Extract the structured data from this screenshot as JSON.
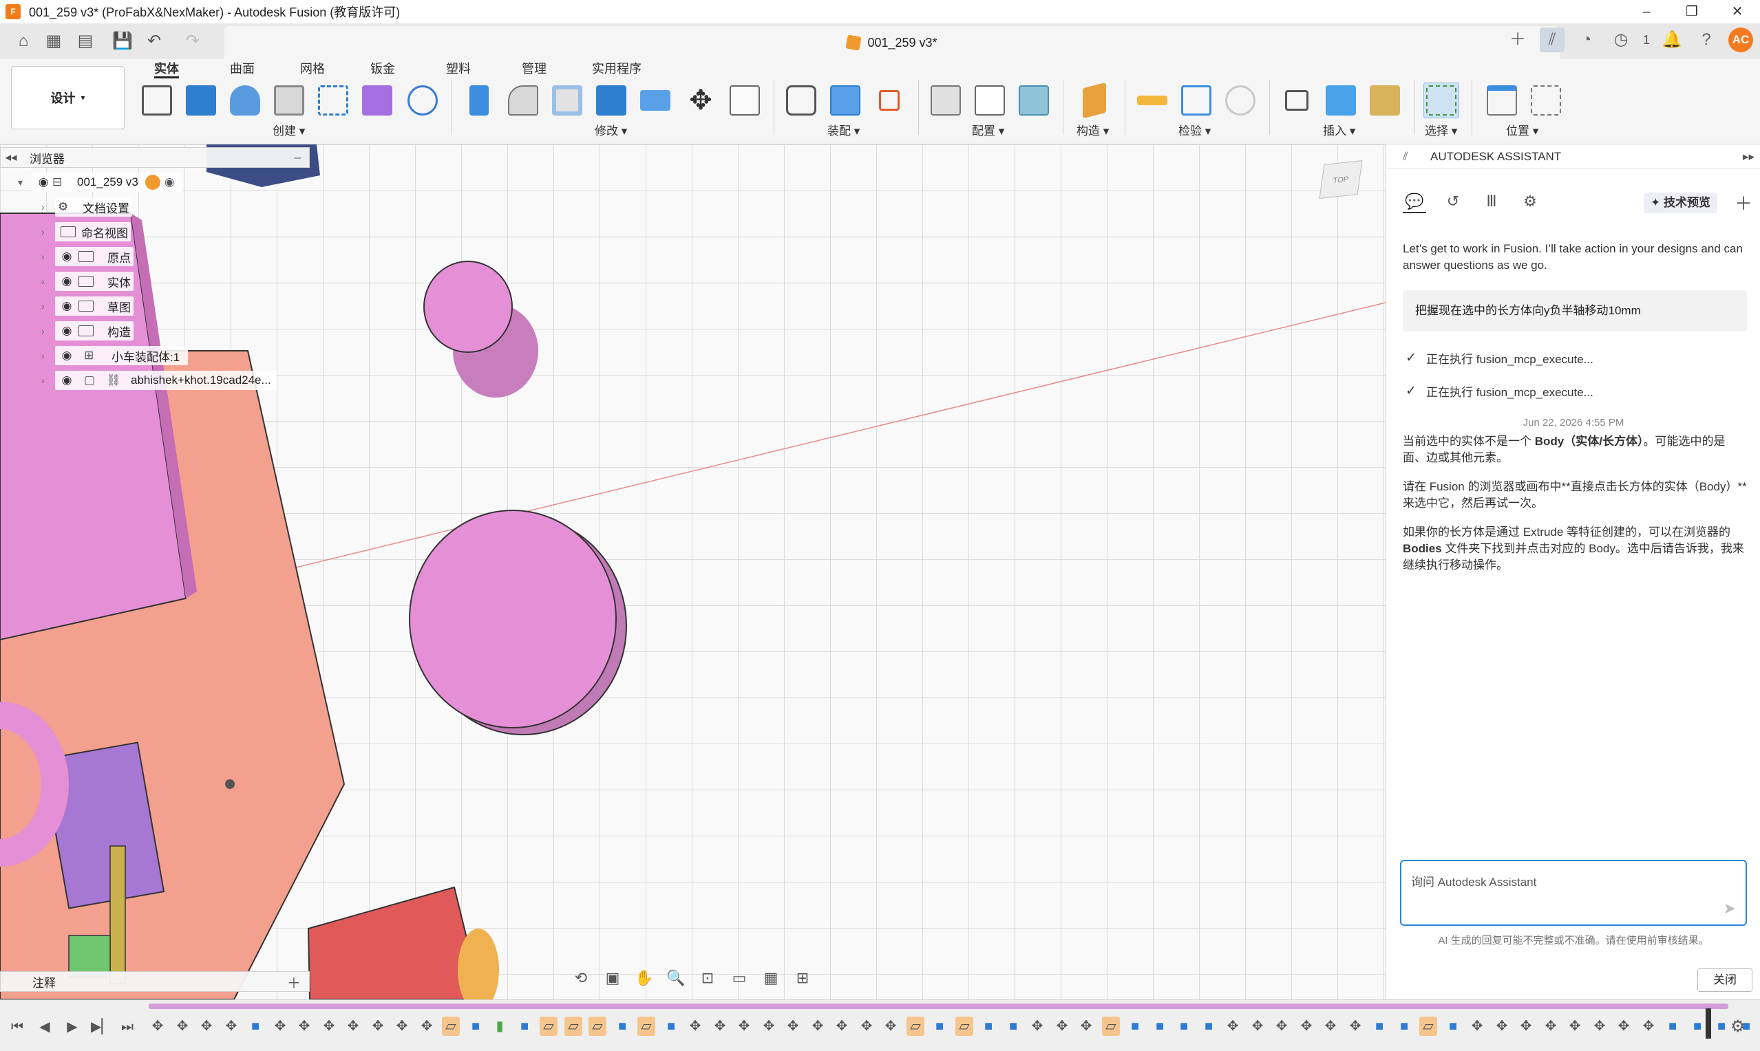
{
  "window": {
    "title": "001_259 v3* (ProFabX&NexMaker) - Autodesk Fusion (教育版许可)",
    "app_logo_text": "F",
    "minimize": "–",
    "restore": "❐",
    "close": "✕"
  },
  "document_tab": {
    "label": "001_259 v3*",
    "close": "✕"
  },
  "top_right": {
    "job_count": "1",
    "avatar_initials": "AC"
  },
  "ribbon": {
    "workspace": "设计",
    "tabs": [
      "实体",
      "曲面",
      "网格",
      "钣金",
      "塑料",
      "管理",
      "实用程序"
    ],
    "active_tab": "实体",
    "groups": [
      "创建",
      "修改",
      "装配",
      "配置",
      "构造",
      "检验",
      "插入",
      "选择",
      "位置"
    ]
  },
  "browser": {
    "title": "浏览器",
    "root": "001_259 v3",
    "items": [
      "文档设置",
      "命名视图",
      "原点",
      "实体",
      "草图",
      "构造",
      "小车装配体:1",
      "abhishek+khot.19cad24e..."
    ],
    "notes": "注释"
  },
  "viewcube": {
    "label": "TOP"
  },
  "assistant": {
    "header": "AUTODESK ASSISTANT",
    "preview_label": "技术预览",
    "intro": "Let’s get to work in Fusion. I’ll take action in your designs and can answer questions as we go.",
    "user_message": "把握现在选中的长方体向y负半轴移动10mm",
    "tool_steps": [
      "正在执行 fusion_mcp_execute...",
      "正在执行 fusion_mcp_execute..."
    ],
    "timestamp": "Jun 22, 2026 4:55 PM",
    "reply_p1_a": "当前选中的实体不是一个 ",
    "reply_p1_b": "Body（实体/长方体）",
    "reply_p1_c": "。可能选中的是面、边或其他元素。",
    "reply_p2": "请在 Fusion 的浏览器或画布中**直接点击长方体的实体（Body）**来选中它，然后再试一次。",
    "reply_p3_a": "如果你的长方体是通过 Extrude 等特征创建的，可以在浏览器的 ",
    "reply_p3_b": "Bodies",
    "reply_p3_c": " 文件夹下找到并点击对应的 Body。选中后请告诉我，我来继续执行移动操作。",
    "input_placeholder": "询问 Autodesk Assistant",
    "disclaimer": "AI 生成的回复可能不完整或不准确。请在使用前审核结果。",
    "close_button": "关闭"
  },
  "colors": {
    "accent": "#2b84d9",
    "body_pink": "#e48fd6",
    "plate_salmon": "#f4a08f",
    "sketch_orange": "#f6c58e"
  }
}
